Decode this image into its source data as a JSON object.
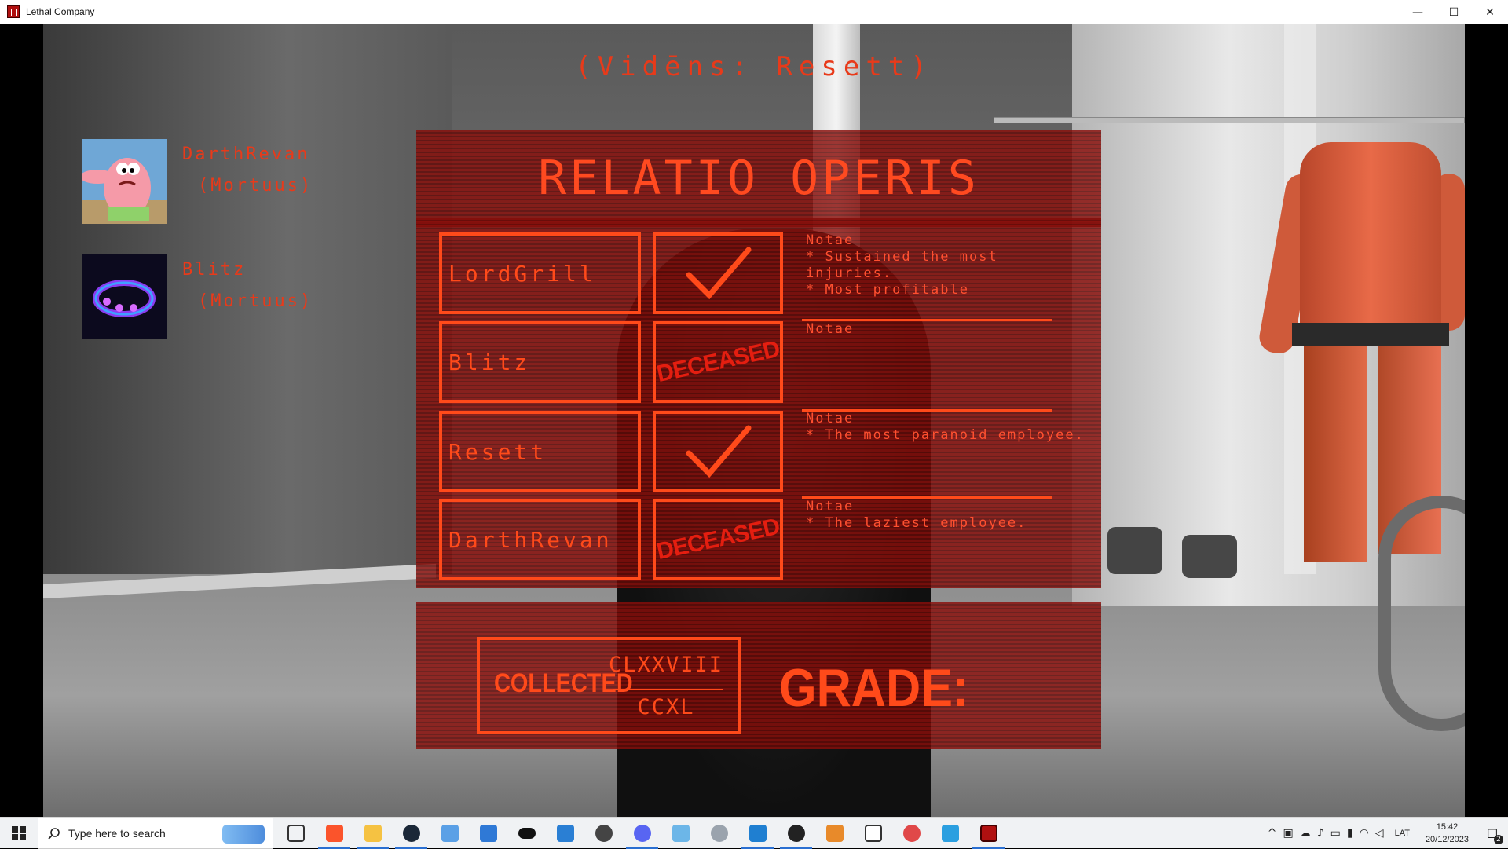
{
  "window": {
    "title": "Lethal Company",
    "controls": {
      "minimize": "—",
      "maximize": "☐",
      "close": "✕"
    }
  },
  "hud": {
    "spectating": "(Vidēns:  Resett)",
    "players": [
      {
        "name": "DarthRevan",
        "status": "(Mortuus)"
      },
      {
        "name": "Blitz",
        "status": "(Mortuus)"
      }
    ]
  },
  "report": {
    "title": "RELATIO OPERIS",
    "rows": [
      {
        "name": "LordGrill",
        "status": "check",
        "notes_label": "Notae",
        "notes": [
          "* Sustained the most",
          "injuries.",
          "* Most profitable"
        ]
      },
      {
        "name": "Blitz",
        "status": "DECEASED",
        "notes_label": "Notae",
        "notes": []
      },
      {
        "name": "Resett",
        "status": "check",
        "notes_label": "Notae",
        "notes": [
          "* The most paranoid employee."
        ]
      },
      {
        "name": "DarthRevan",
        "status": "DECEASED",
        "notes_label": "Notae",
        "notes": [
          "* The laziest employee."
        ]
      }
    ],
    "collected_label": "COLLECTED",
    "collected_value": "CLXXVIII",
    "collected_total": "CCXL",
    "grade_label": "GRADE:"
  },
  "taskbar": {
    "search_placeholder": "Type here to search",
    "pinned": [
      "task-view-icon",
      "brave-icon",
      "file-explorer-icon",
      "steam-icon",
      "app-window-icon",
      "app-window-icon-2",
      "oculus-icon",
      "photos-icon",
      "settings-icon",
      "discord-icon",
      "notepad-icon",
      "app-round-icon",
      "vscode-icon",
      "obs-icon",
      "sublime-icon",
      "monitor-icon",
      "snip-icon",
      "app-blue-icon",
      "lethal-company-icon"
    ],
    "language": "LAT",
    "time": "15:42",
    "date": "20/12/2023",
    "notification_count": "2"
  },
  "colors": {
    "hud_red": "#e83a1a",
    "panel_red": "#8a0e0a",
    "stamp_red": "#e41e10"
  }
}
